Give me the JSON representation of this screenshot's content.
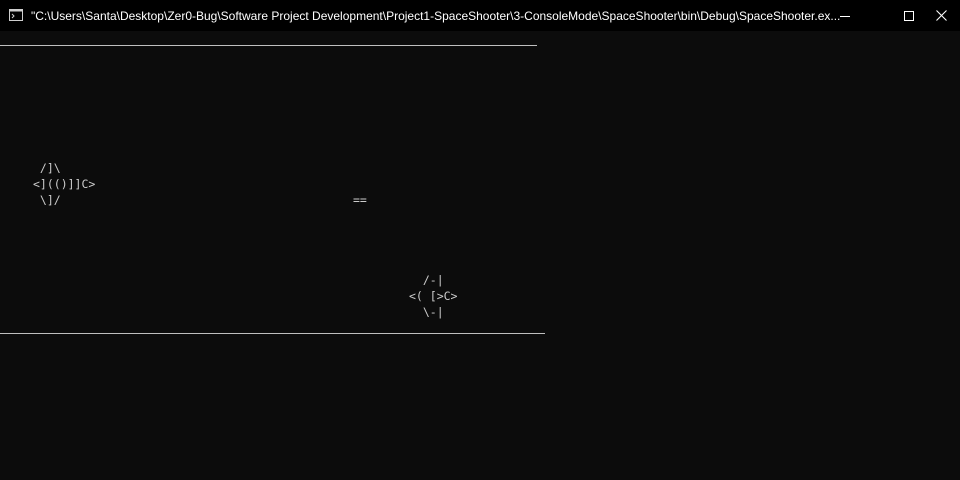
{
  "window": {
    "title": "\"C:\\Users\\Santa\\Desktop\\Zer0-Bug\\Software Project Development\\Project1-SpaceShooter\\3-ConsoleMode\\SpaceShooter\\bin\\Debug\\SpaceShooter.ex...",
    "icon": "console-app-icon",
    "controls": {
      "minimize_icon": "minimize-icon",
      "maximize_icon": "maximize-icon",
      "close_icon": "close-icon"
    }
  },
  "console": {
    "background": "#0c0c0c",
    "text_color": "#cccccc",
    "player_ship": " /]\\\n<](()]]C>\n \\]/",
    "projectile": "==",
    "enemy_ship": "  /-|\n<( [>C>\n  \\-|"
  }
}
